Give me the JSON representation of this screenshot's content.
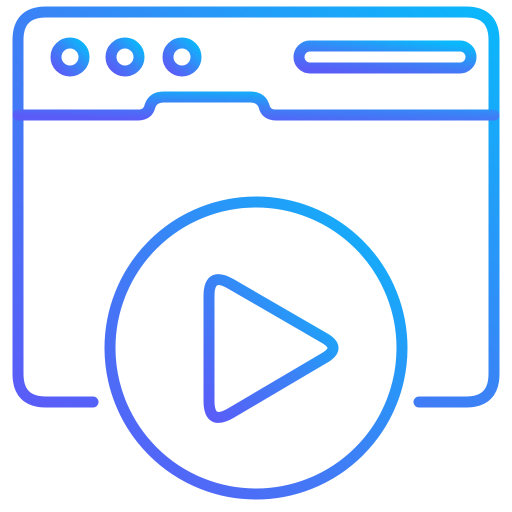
{
  "icon": {
    "name": "video-player-browser-icon",
    "style": "outline",
    "gradient": {
      "start": "#5a5cf7",
      "mid": "#3b82f6",
      "end": "#0ab8fb"
    },
    "elements": [
      "browser-window-icon",
      "window-dot-icon",
      "address-bar-icon",
      "tab-bump-icon",
      "play-circle-icon",
      "play-triangle-icon"
    ]
  }
}
